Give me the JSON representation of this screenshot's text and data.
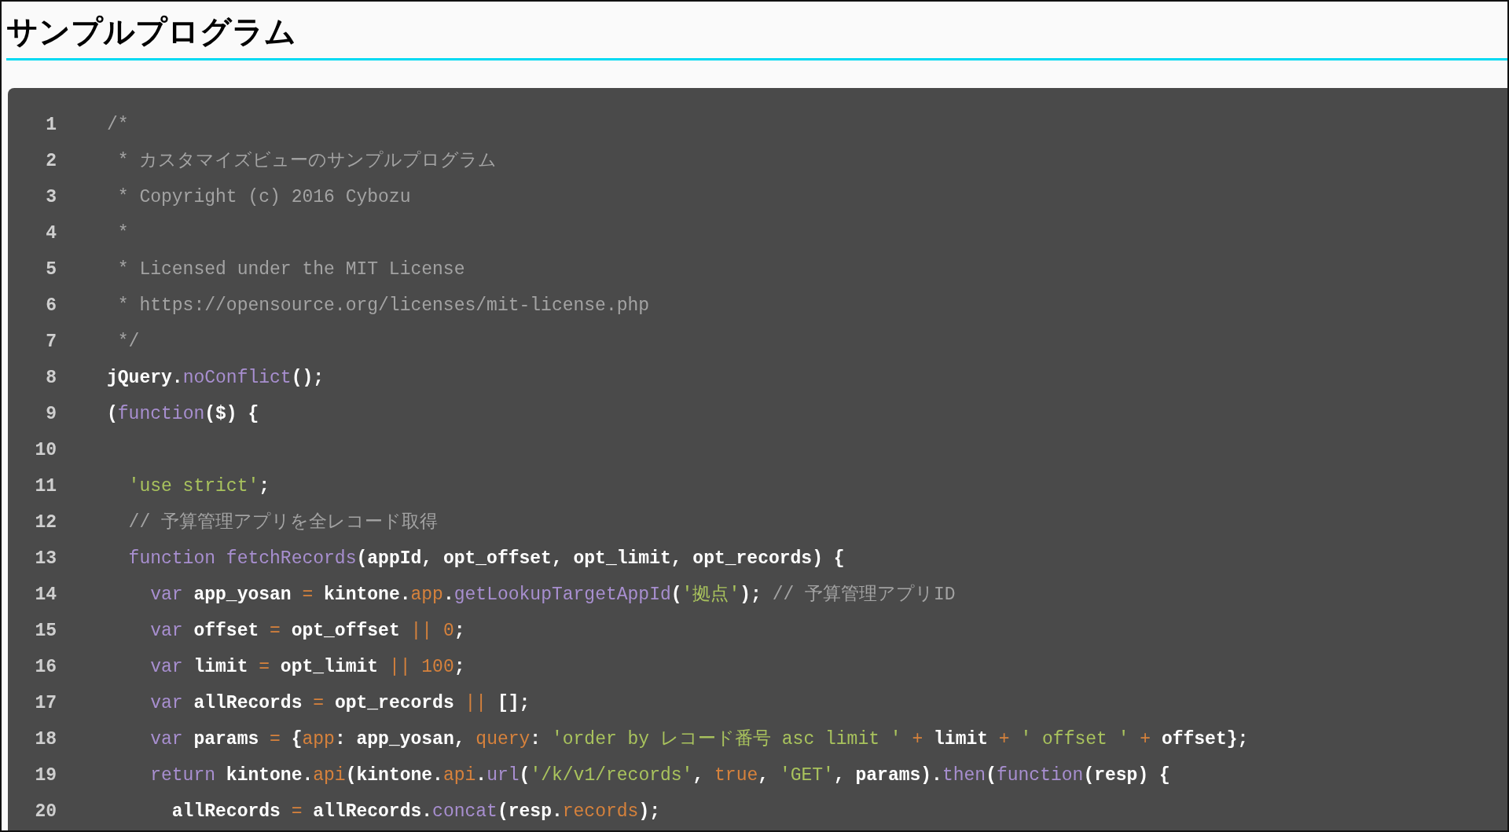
{
  "heading": "サンプルプログラム",
  "code": {
    "lines": [
      {
        "number": "1",
        "tokens": [
          {
            "kind": "comment",
            "text": "/*"
          }
        ]
      },
      {
        "number": "2",
        "tokens": [
          {
            "kind": "comment",
            "text": " * カスタマイズビューのサンプルプログラム"
          }
        ]
      },
      {
        "number": "3",
        "tokens": [
          {
            "kind": "comment",
            "text": " * Copyright (c) 2016 Cybozu"
          }
        ]
      },
      {
        "number": "4",
        "tokens": [
          {
            "kind": "comment",
            "text": " *"
          }
        ]
      },
      {
        "number": "5",
        "tokens": [
          {
            "kind": "comment",
            "text": " * Licensed under the MIT License"
          }
        ]
      },
      {
        "number": "6",
        "tokens": [
          {
            "kind": "comment",
            "text": " * https://opensource.org/licenses/mit-license.php"
          }
        ]
      },
      {
        "number": "7",
        "tokens": [
          {
            "kind": "comment",
            "text": " */"
          }
        ]
      },
      {
        "number": "8",
        "tokens": [
          {
            "kind": "plain",
            "text": "jQuery."
          },
          {
            "kind": "function",
            "text": "noConflict"
          },
          {
            "kind": "plain",
            "text": "();"
          }
        ]
      },
      {
        "number": "9",
        "tokens": [
          {
            "kind": "plain",
            "text": "("
          },
          {
            "kind": "keyword",
            "text": "function"
          },
          {
            "kind": "plain",
            "text": "($) {"
          }
        ]
      },
      {
        "number": "10"
      },
      {
        "number": "11",
        "tokens": [
          {
            "kind": "string",
            "text": "  'use strict'"
          },
          {
            "kind": "plain",
            "text": ";"
          }
        ]
      },
      {
        "number": "12",
        "tokens": [
          {
            "kind": "comment",
            "text": "  // 予算管理アプリを全レコード取得"
          }
        ]
      },
      {
        "number": "13",
        "tokens": [
          {
            "kind": "keyword",
            "text": "  function "
          },
          {
            "kind": "function",
            "text": "fetchRecords"
          },
          {
            "kind": "plain",
            "text": "(appId, opt_offset, opt_limit, opt_records) {"
          }
        ]
      },
      {
        "number": "14",
        "tokens": [
          {
            "kind": "keyword",
            "text": "    var"
          },
          {
            "kind": "plain",
            "text": " app_yosan "
          },
          {
            "kind": "operator",
            "text": "="
          },
          {
            "kind": "plain",
            "text": " kintone."
          },
          {
            "kind": "property",
            "text": "app"
          },
          {
            "kind": "plain",
            "text": "."
          },
          {
            "kind": "function",
            "text": "getLookupTargetAppId"
          },
          {
            "kind": "plain",
            "text": "("
          },
          {
            "kind": "string",
            "text": "'拠点'"
          },
          {
            "kind": "plain",
            "text": "); "
          },
          {
            "kind": "comment",
            "text": "// 予算管理アプリID"
          }
        ]
      },
      {
        "number": "15",
        "tokens": [
          {
            "kind": "keyword",
            "text": "    var"
          },
          {
            "kind": "plain",
            "text": " offset "
          },
          {
            "kind": "operator",
            "text": "="
          },
          {
            "kind": "plain",
            "text": " opt_offset "
          },
          {
            "kind": "operator",
            "text": "|| "
          },
          {
            "kind": "number",
            "text": "0"
          },
          {
            "kind": "plain",
            "text": ";"
          }
        ]
      },
      {
        "number": "16",
        "tokens": [
          {
            "kind": "keyword",
            "text": "    var"
          },
          {
            "kind": "plain",
            "text": " limit "
          },
          {
            "kind": "operator",
            "text": "="
          },
          {
            "kind": "plain",
            "text": " opt_limit "
          },
          {
            "kind": "operator",
            "text": "|| "
          },
          {
            "kind": "number",
            "text": "100"
          },
          {
            "kind": "plain",
            "text": ";"
          }
        ]
      },
      {
        "number": "17",
        "tokens": [
          {
            "kind": "keyword",
            "text": "    var"
          },
          {
            "kind": "plain",
            "text": " allRecords "
          },
          {
            "kind": "operator",
            "text": "="
          },
          {
            "kind": "plain",
            "text": " opt_records "
          },
          {
            "kind": "operator",
            "text": "||"
          },
          {
            "kind": "plain",
            "text": " [];"
          }
        ]
      },
      {
        "number": "18",
        "tokens": [
          {
            "kind": "keyword",
            "text": "    var"
          },
          {
            "kind": "plain",
            "text": " params "
          },
          {
            "kind": "operator",
            "text": "="
          },
          {
            "kind": "plain",
            "text": " {"
          },
          {
            "kind": "property",
            "text": "app"
          },
          {
            "kind": "plain",
            "text": ": app_yosan, "
          },
          {
            "kind": "property",
            "text": "query"
          },
          {
            "kind": "plain",
            "text": ": "
          },
          {
            "kind": "string",
            "text": "'order by レコード番号 asc limit ' "
          },
          {
            "kind": "operator",
            "text": "+"
          },
          {
            "kind": "plain",
            "text": " limit "
          },
          {
            "kind": "operator",
            "text": "+ "
          },
          {
            "kind": "string",
            "text": "' offset ' "
          },
          {
            "kind": "operator",
            "text": "+"
          },
          {
            "kind": "plain",
            "text": " offset};"
          }
        ]
      },
      {
        "number": "19",
        "tokens": [
          {
            "kind": "keyword",
            "text": "    return"
          },
          {
            "kind": "plain",
            "text": " kintone."
          },
          {
            "kind": "property",
            "text": "api"
          },
          {
            "kind": "plain",
            "text": "(kintone."
          },
          {
            "kind": "property",
            "text": "api"
          },
          {
            "kind": "plain",
            "text": "."
          },
          {
            "kind": "function",
            "text": "url"
          },
          {
            "kind": "plain",
            "text": "("
          },
          {
            "kind": "string",
            "text": "'/k/v1/records'"
          },
          {
            "kind": "plain",
            "text": ", "
          },
          {
            "kind": "number",
            "text": "true"
          },
          {
            "kind": "plain",
            "text": ", "
          },
          {
            "kind": "string",
            "text": "'GET'"
          },
          {
            "kind": "plain",
            "text": ", params)."
          },
          {
            "kind": "function",
            "text": "then"
          },
          {
            "kind": "plain",
            "text": "("
          },
          {
            "kind": "keyword",
            "text": "function"
          },
          {
            "kind": "plain",
            "text": "(resp) {"
          }
        ]
      },
      {
        "number": "20",
        "tokens": [
          {
            "kind": "plain",
            "text": "      allRecords "
          },
          {
            "kind": "operator",
            "text": "="
          },
          {
            "kind": "plain",
            "text": " allRecords."
          },
          {
            "kind": "function",
            "text": "concat"
          },
          {
            "kind": "plain",
            "text": "(resp."
          },
          {
            "kind": "property",
            "text": "records"
          },
          {
            "kind": "plain",
            "text": ");"
          }
        ]
      }
    ]
  }
}
